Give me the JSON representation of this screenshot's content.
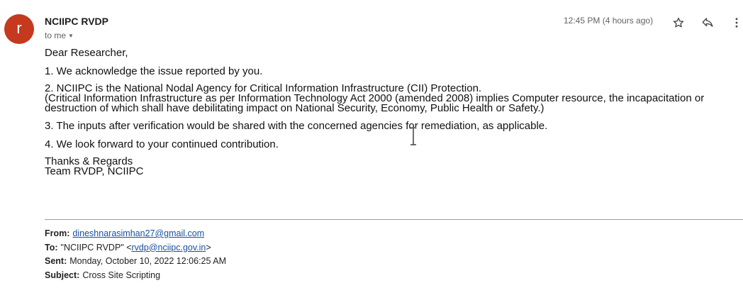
{
  "sender": {
    "avatar_letter": "r",
    "name": "NCIIPC RVDP",
    "to_label": "to me",
    "timestamp": "12:45 PM (4 hours ago)",
    "avatar_color": "#c5391e"
  },
  "actions": {
    "star_icon": "star-icon",
    "reply_icon": "reply-icon",
    "more_icon": "more-vert-icon"
  },
  "message": {
    "greeting": "Dear Researcher,",
    "p1": "1. We acknowledge the issue reported by you.",
    "p2_line1": "2. NCIIPC is the National Nodal Agency for Critical Information Infrastructure (CII) Protection.",
    "p2_line2": "(Critical Information Infrastructure as per Information Technology Act 2000 (amended 2008) implies Computer resource, the incapacitation or destruction of which shall have debilitating impact on National Security, Economy, Public Health or Safety.)",
    "p3": "3. The inputs after verification would be shared with the concerned agencies for remediation, as applicable.",
    "p4": "4. We look forward to your continued contribution.",
    "signoff": "Thanks & Regards",
    "team": "Team RVDP, NCIIPC"
  },
  "quoted": {
    "from_label": "From:",
    "from_value": "dineshnarasimhan27@gmail.com",
    "to_label": "To:",
    "to_prefix": "\"NCIIPC RVDP\" <",
    "to_email": "rvdp@nciipc.gov.in",
    "to_suffix": ">",
    "sent_label": "Sent:",
    "sent_value": "Monday, October 10, 2022 12:06:25 AM",
    "subject_label": "Subject:",
    "subject_value": "Cross Site Scripting"
  }
}
